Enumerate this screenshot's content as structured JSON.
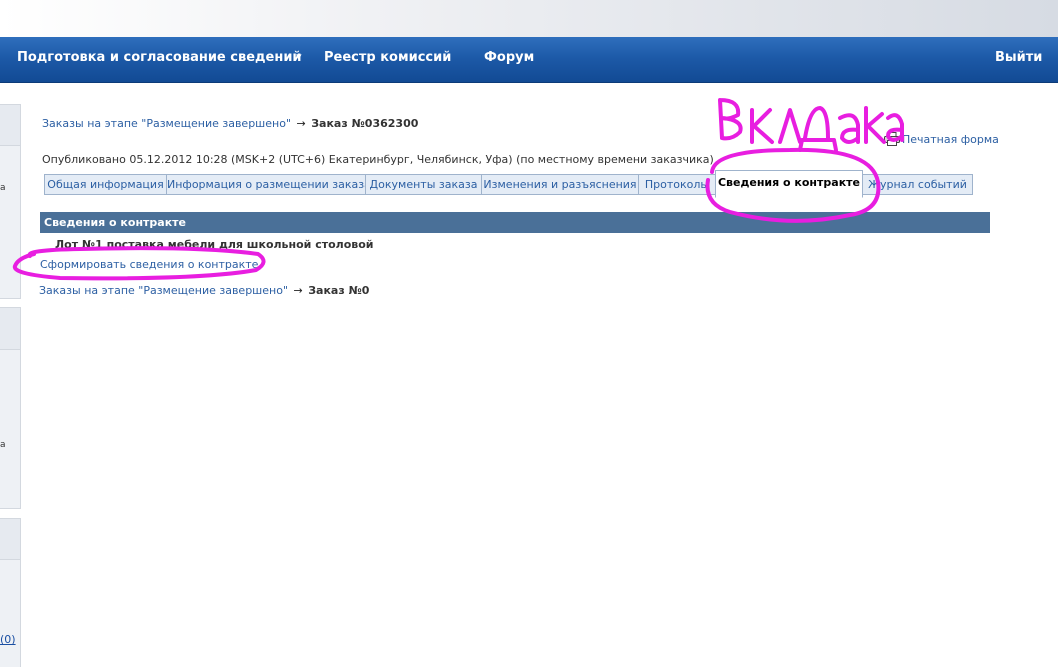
{
  "nav": {
    "items": [
      {
        "label": "Подготовка и согласование сведений"
      },
      {
        "label": "Реестр комиссий"
      },
      {
        "label": "Форум"
      }
    ],
    "dropdown_glyph": "▾",
    "logout_label": "Выйти"
  },
  "sidebar": {
    "fragments": [
      "а",
      "а"
    ],
    "bottom_link": "(0)"
  },
  "breadcrumb": {
    "root": "Заказы на этапе \"Размещение завершено\"",
    "arrow": "→",
    "current_top": "Заказ №0362300",
    "current_bottom": "Заказ №0"
  },
  "published": "Опубликовано 05.12.2012 10:28 (MSK+2 (UTC+6) Екатеринбург, Челябинск, Уфа) (по местному времени заказчика)",
  "print_label": "Печатная форма",
  "print_icon": "printer-icon",
  "tabs": [
    {
      "label": "Общая информация"
    },
    {
      "label": "Информация о размещении заказа"
    },
    {
      "label": "Документы заказа"
    },
    {
      "label": "Изменения и разъяснения"
    },
    {
      "label": "Протоколы"
    },
    {
      "label": "Сведения о контракте"
    },
    {
      "label": "Журнал событий"
    }
  ],
  "active_tab": "Сведения о контракте",
  "section": {
    "title": "Сведения о контракте",
    "lot": "Лот №1 поставка мебели для школьной столовой",
    "action_link": "Сформировать сведения о контракте"
  },
  "annotation": {
    "handwritten_text": "вкладка",
    "color": "#e81ee0"
  },
  "colors": {
    "nav": "#1d5aa8",
    "link": "#2c5fa3",
    "section_bar": "#4a7098",
    "tab_bg": "#e4ecf6"
  }
}
